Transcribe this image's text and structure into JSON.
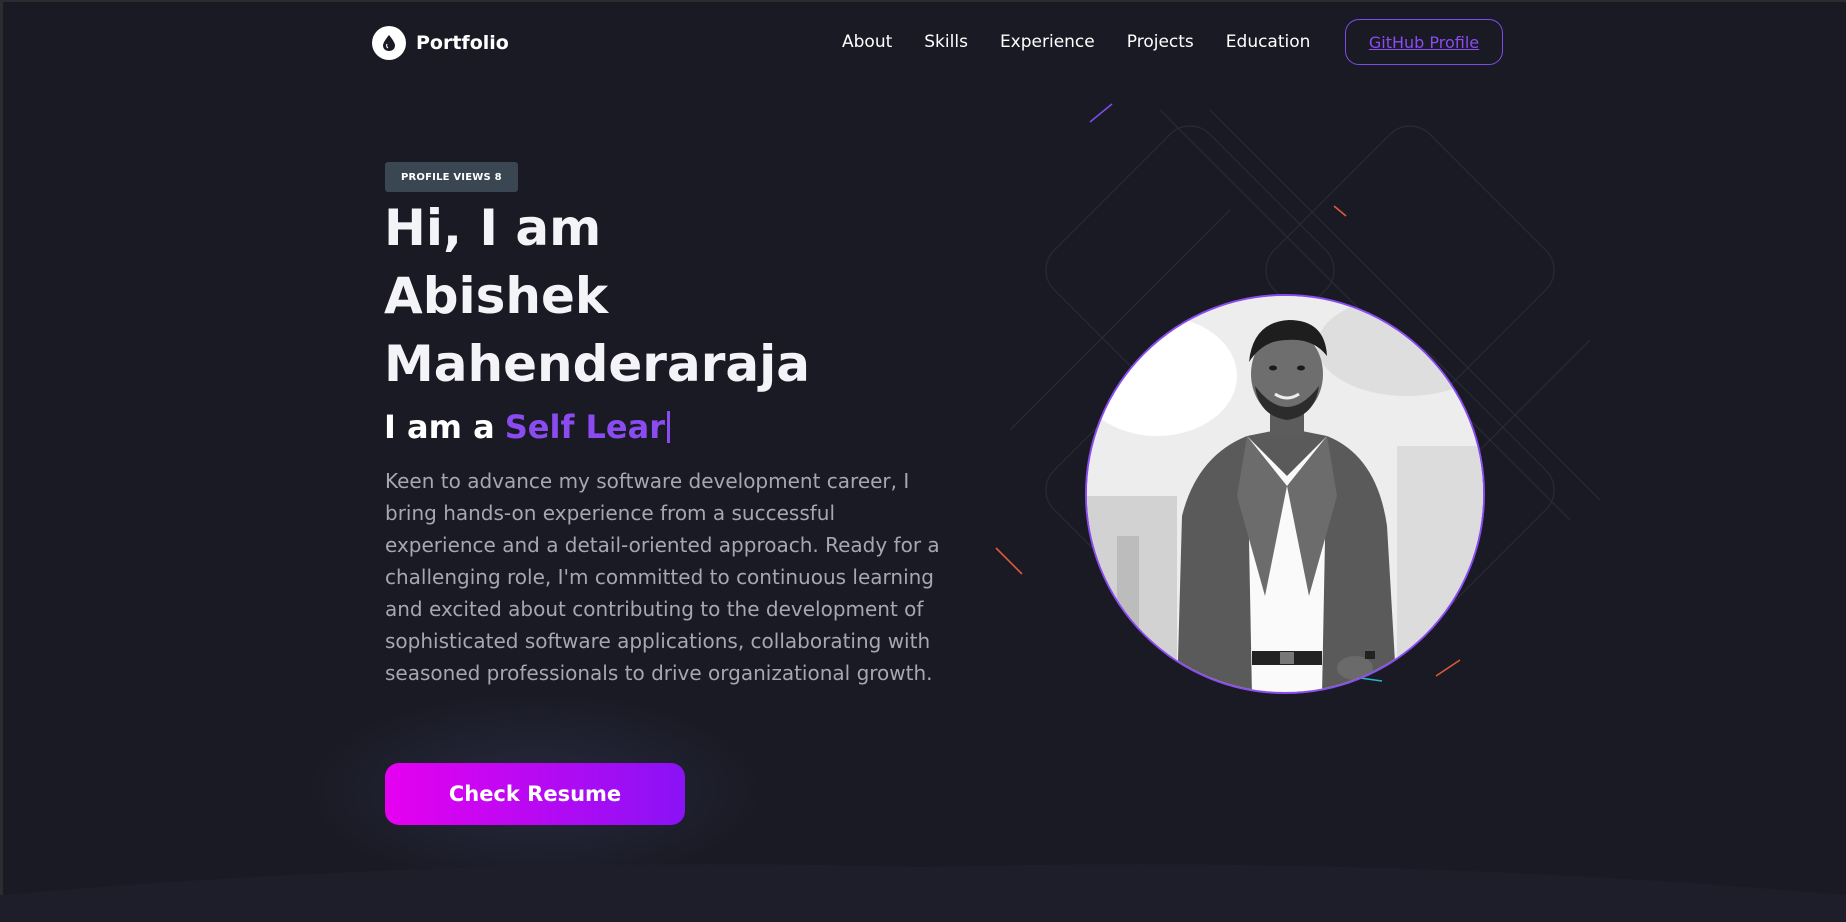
{
  "header": {
    "logo_text": "Portfolio",
    "logo_icon": "drop-icon",
    "nav": [
      "About",
      "Skills",
      "Experience",
      "Projects",
      "Education"
    ],
    "github_button": "GitHub Profile"
  },
  "hero": {
    "badge": "PROFILE VIEWS 8",
    "title_lines": [
      "Hi, I am",
      "Abishek",
      "Mahenderaraja"
    ],
    "role_prefix": "I am a",
    "role_typed": "Self Lear",
    "bio": "Keen to advance my software development career, I bring hands-on experience from a successful experience and a detail-oriented approach. Ready for a challenging role, I'm committed to continuous learning and excited about contributing to the development of sophisticated software applications, collaborating with seasoned professionals to drive organizational growth.",
    "cta_button": "Check Resume"
  },
  "colors": {
    "background": "#1a1a24",
    "accent_purple": "#8a4cf0",
    "cta_gradient_start": "#e600f0",
    "cta_gradient_end": "#8a12f5",
    "badge_bg": "#3a4753",
    "muted_text": "#a6a6b4"
  }
}
